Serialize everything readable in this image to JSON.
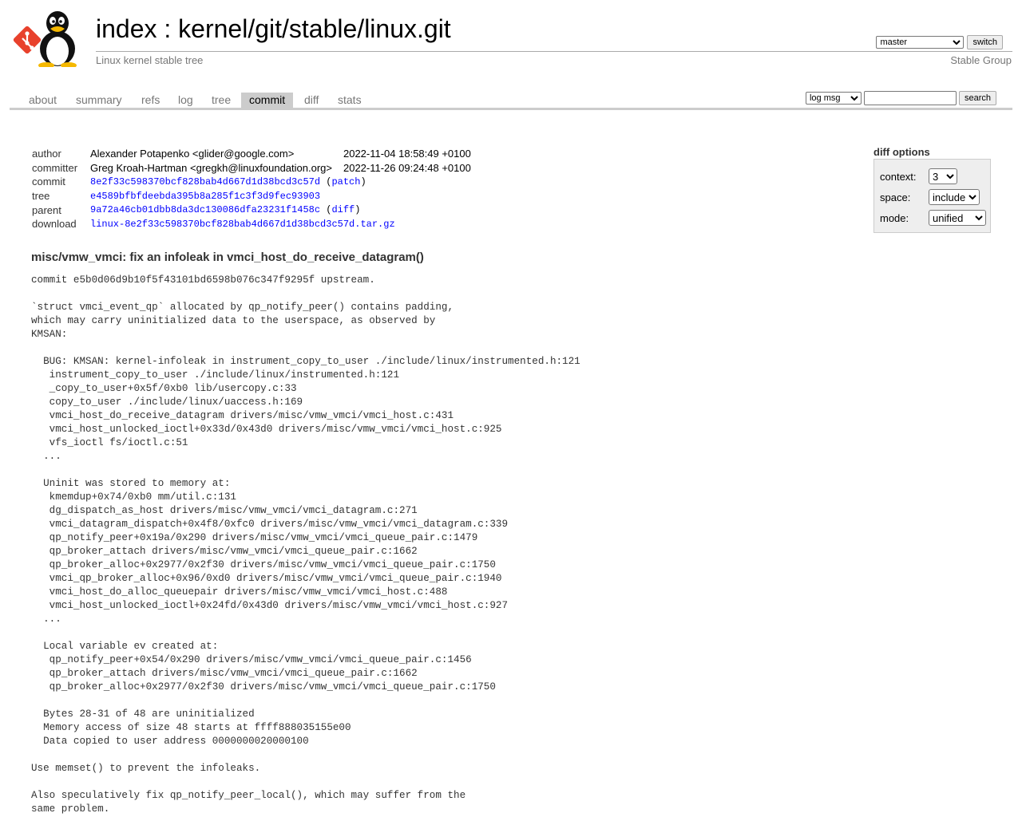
{
  "header": {
    "title_prefix": "index",
    "title_separator": " : ",
    "title_repo": "kernel/git/stable/linux.git",
    "description": "Linux kernel stable tree",
    "owner": "Stable Group",
    "branch_selected": "master",
    "switch_label": "switch"
  },
  "tabs": [
    "about",
    "summary",
    "refs",
    "log",
    "tree",
    "commit",
    "diff",
    "stats"
  ],
  "active_tab": "commit",
  "search": {
    "grep_selected": "log msg",
    "input_value": "",
    "button_label": "search"
  },
  "commit_info": {
    "author_label": "author",
    "author": "Alexander Potapenko <glider@google.com>",
    "author_date": "2022-11-04 18:58:49 +0100",
    "committer_label": "committer",
    "committer": "Greg Kroah-Hartman <gregkh@linuxfoundation.org>",
    "committer_date": "2022-11-26 09:24:48 +0100",
    "commit_label": "commit",
    "commit_sha": "8e2f33c598370bcf828bab4d667d1d38bcd3c57d",
    "patch_link": "patch",
    "tree_label": "tree",
    "tree_sha": "e4589bfbfdeebda395b8a285f1c3f3d9fec93903",
    "parent_label": "parent",
    "parent_sha": "9a72a46cb01dbb8da3dc130086dfa23231f1458c",
    "diff_link": "diff",
    "download_label": "download",
    "download_file": "linux-8e2f33c598370bcf828bab4d667d1d38bcd3c57d.tar.gz"
  },
  "diff_options": {
    "heading": "diff options",
    "context_label": "context:",
    "context_value": "3",
    "space_label": "space:",
    "space_value": "include",
    "mode_label": "mode:",
    "mode_value": "unified"
  },
  "subject": "misc/vmw_vmci: fix an infoleak in vmci_host_do_receive_datagram()",
  "message": "commit e5b0d06d9b10f5f43101bd6598b076c347f9295f upstream.\n\n`struct vmci_event_qp` allocated by qp_notify_peer() contains padding,\nwhich may carry uninitialized data to the userspace, as observed by\nKMSAN:\n\n  BUG: KMSAN: kernel-infoleak in instrument_copy_to_user ./include/linux/instrumented.h:121\n   instrument_copy_to_user ./include/linux/instrumented.h:121\n   _copy_to_user+0x5f/0xb0 lib/usercopy.c:33\n   copy_to_user ./include/linux/uaccess.h:169\n   vmci_host_do_receive_datagram drivers/misc/vmw_vmci/vmci_host.c:431\n   vmci_host_unlocked_ioctl+0x33d/0x43d0 drivers/misc/vmw_vmci/vmci_host.c:925\n   vfs_ioctl fs/ioctl.c:51\n  ...\n\n  Uninit was stored to memory at:\n   kmemdup+0x74/0xb0 mm/util.c:131\n   dg_dispatch_as_host drivers/misc/vmw_vmci/vmci_datagram.c:271\n   vmci_datagram_dispatch+0x4f8/0xfc0 drivers/misc/vmw_vmci/vmci_datagram.c:339\n   qp_notify_peer+0x19a/0x290 drivers/misc/vmw_vmci/vmci_queue_pair.c:1479\n   qp_broker_attach drivers/misc/vmw_vmci/vmci_queue_pair.c:1662\n   qp_broker_alloc+0x2977/0x2f30 drivers/misc/vmw_vmci/vmci_queue_pair.c:1750\n   vmci_qp_broker_alloc+0x96/0xd0 drivers/misc/vmw_vmci/vmci_queue_pair.c:1940\n   vmci_host_do_alloc_queuepair drivers/misc/vmw_vmci/vmci_host.c:488\n   vmci_host_unlocked_ioctl+0x24fd/0x43d0 drivers/misc/vmw_vmci/vmci_host.c:927\n  ...\n\n  Local variable ev created at:\n   qp_notify_peer+0x54/0x290 drivers/misc/vmw_vmci/vmci_queue_pair.c:1456\n   qp_broker_attach drivers/misc/vmw_vmci/vmci_queue_pair.c:1662\n   qp_broker_alloc+0x2977/0x2f30 drivers/misc/vmw_vmci/vmci_queue_pair.c:1750\n\n  Bytes 28-31 of 48 are uninitialized\n  Memory access of size 48 starts at ffff888035155e00\n  Data copied to user address 0000000020000100\n\nUse memset() to prevent the infoleaks.\n\nAlso speculatively fix qp_notify_peer_local(), which may suffer from the\nsame problem.",
  "colors": {
    "link": "#0000ff",
    "tab_active_bg": "#cccccc",
    "git_logo": "#e8412c"
  }
}
